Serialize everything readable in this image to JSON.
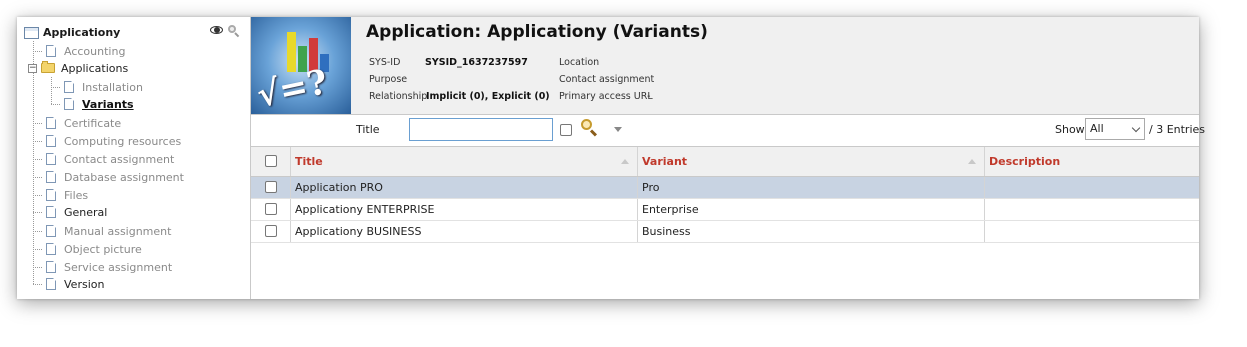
{
  "sidebar": {
    "root_label": "Applicationy",
    "items": [
      {
        "label": "Accounting"
      },
      {
        "label": "Applications"
      },
      {
        "label": "Installation"
      },
      {
        "label": "Variants"
      },
      {
        "label": "Certificate"
      },
      {
        "label": "Computing resources"
      },
      {
        "label": "Contact assignment"
      },
      {
        "label": "Database assignment"
      },
      {
        "label": "Files"
      },
      {
        "label": "General"
      },
      {
        "label": "Manual assignment"
      },
      {
        "label": "Object picture"
      },
      {
        "label": "Service assignment"
      },
      {
        "label": "Version"
      }
    ]
  },
  "header": {
    "title": "Application: Applicationy (Variants)",
    "sysid_label": "SYS-ID",
    "sysid_value": "SYSID_1637237597",
    "purpose_label": "Purpose",
    "relationship_label": "Relationship",
    "relationship_value": "Implicit (0), Explicit (0)",
    "location_label": "Location",
    "contact_label": "Contact assignment",
    "primary_url_label": "Primary access URL",
    "primary_url_value": "-",
    "logo_formula": "√=?"
  },
  "filter": {
    "title_label": "Title",
    "title_value": "",
    "show_label": "Show",
    "show_value": "All",
    "entries_label": "/ 3 Entries"
  },
  "table": {
    "columns": [
      "Title",
      "Variant",
      "Description"
    ],
    "rows": [
      {
        "title": "Application PRO",
        "variant": "Pro",
        "description": ""
      },
      {
        "title": "Applicationy ENTERPRISE",
        "variant": "Enterprise",
        "description": ""
      },
      {
        "title": "Applicationy BUSINESS",
        "variant": "Business",
        "description": ""
      }
    ]
  },
  "colors": {
    "header_accent": "#c0392b",
    "selected_row": "#c8d3e2"
  }
}
